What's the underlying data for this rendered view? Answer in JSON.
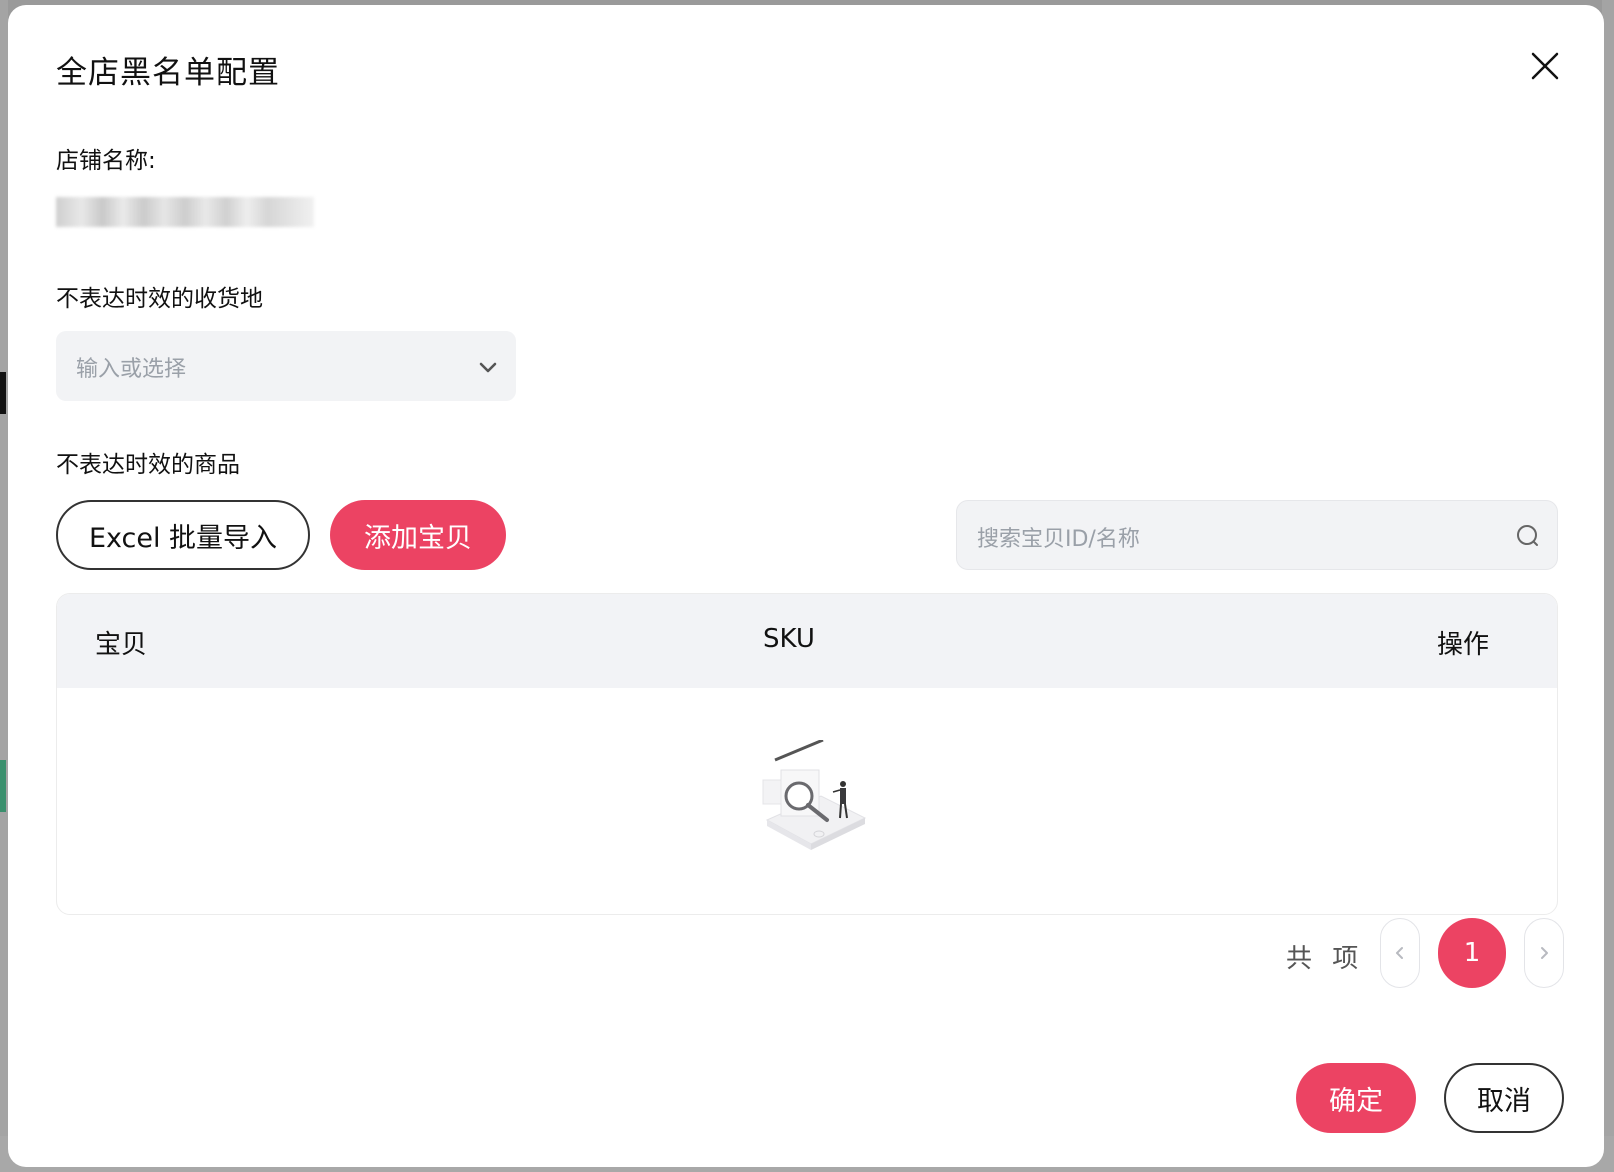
{
  "modal": {
    "title": "全店黑名单配置",
    "shop_label": "店铺名称:",
    "destination_label": "不表达时效的收货地",
    "destination_placeholder": "输入或选择",
    "goods_label": "不表达时效的商品",
    "excel_import_label": "Excel 批量导入",
    "add_item_label": "添加宝贝",
    "search_placeholder": "搜索宝贝ID/名称",
    "table": {
      "columns": [
        "宝贝",
        "SKU",
        "操作"
      ],
      "rows": []
    },
    "pagination": {
      "total_text": "共 项",
      "current_page": "1"
    },
    "confirm_label": "确定",
    "cancel_label": "取消"
  },
  "colors": {
    "primary": "#ec4363",
    "input_bg": "#f2f3f5",
    "table_header_bg": "#f2f3f6"
  },
  "icons": {
    "close": "close-icon",
    "dropdown": "chevron-down-icon",
    "search": "search-icon",
    "prev": "chevron-left-icon",
    "next": "chevron-right-icon",
    "empty": "empty-search-illustration"
  }
}
